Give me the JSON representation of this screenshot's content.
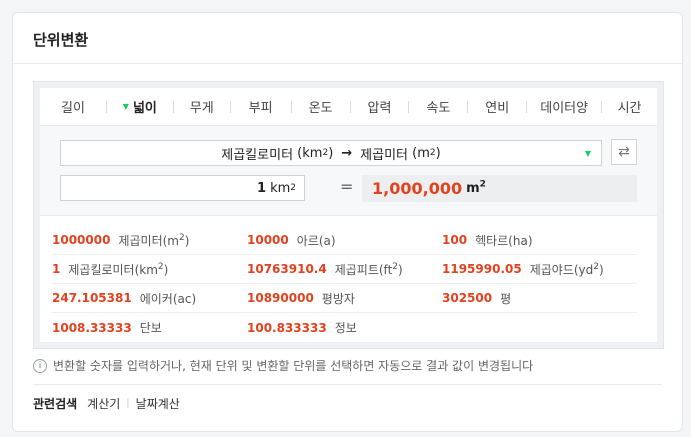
{
  "card": {
    "title": "단위변환"
  },
  "tabs": [
    {
      "label": "길이",
      "active": false
    },
    {
      "label": "넓이",
      "active": true
    },
    {
      "label": "무게",
      "active": false
    },
    {
      "label": "부피",
      "active": false
    },
    {
      "label": "온도",
      "active": false
    },
    {
      "label": "압력",
      "active": false
    },
    {
      "label": "속도",
      "active": false
    },
    {
      "label": "연비",
      "active": false
    },
    {
      "label": "데이터양",
      "active": false
    },
    {
      "label": "시간",
      "active": false
    }
  ],
  "converter": {
    "from_unit_name": "제곱킬로미터",
    "from_unit_symbol": "km",
    "to_unit_name": "제곱미터",
    "to_unit_symbol": "m",
    "arrow": "→",
    "sup": "2",
    "input_value": "1",
    "input_unit": "km",
    "equals": "=",
    "result_value": "1,000,000",
    "result_unit": "m"
  },
  "results": [
    [
      {
        "value": "1000000",
        "unit": "제곱미터(m",
        "unit_tail": ")",
        "sup": "2"
      },
      {
        "value": "10000",
        "unit": "아르(a)",
        "unit_tail": "",
        "sup": ""
      },
      {
        "value": "100",
        "unit": "헥타르(ha)",
        "unit_tail": "",
        "sup": ""
      }
    ],
    [
      {
        "value": "1",
        "unit": "제곱킬로미터(km",
        "unit_tail": ")",
        "sup": "2"
      },
      {
        "value": "10763910.4",
        "unit": "제곱피트(ft",
        "unit_tail": ")",
        "sup": "2"
      },
      {
        "value": "1195990.05",
        "unit": "제곱야드(yd",
        "unit_tail": ")",
        "sup": "2"
      }
    ],
    [
      {
        "value": "247.105381",
        "unit": "에이커(ac)",
        "unit_tail": "",
        "sup": ""
      },
      {
        "value": "10890000",
        "unit": "평방자",
        "unit_tail": "",
        "sup": ""
      },
      {
        "value": "302500",
        "unit": "평",
        "unit_tail": "",
        "sup": ""
      }
    ],
    [
      {
        "value": "1008.33333",
        "unit": "단보",
        "unit_tail": "",
        "sup": ""
      },
      {
        "value": "100.833333",
        "unit": "정보",
        "unit_tail": "",
        "sup": ""
      }
    ]
  ],
  "info": {
    "icon": "i",
    "text": "변환할 숫자를 입력하거나, 현재 단위 및 변환할 단위를 선택하면 자동으로 결과 값이 변경됩니다"
  },
  "related": {
    "label": "관련검색",
    "links": [
      "계산기",
      "날짜계산"
    ]
  },
  "colors": {
    "accent": "#19ce60",
    "value": "#e2421f"
  }
}
